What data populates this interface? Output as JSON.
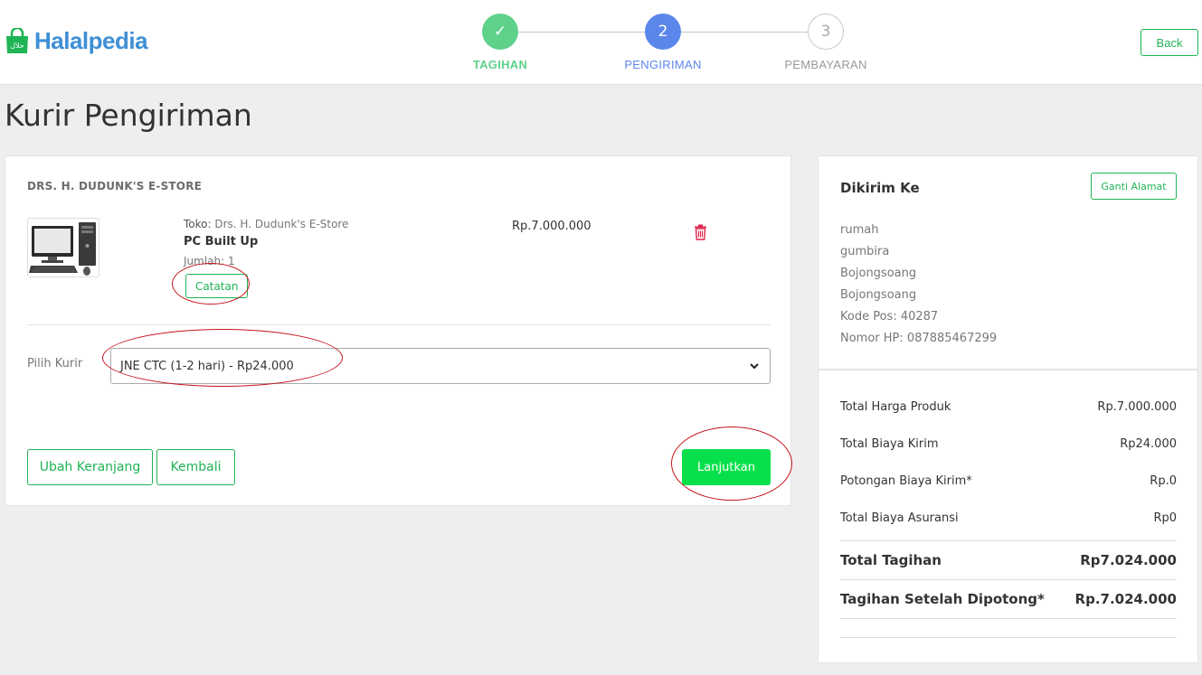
{
  "header": {
    "logo_text": "Halalpedia",
    "logo_badge": "حلال",
    "back_label": "Back",
    "steps": [
      {
        "number": "✓",
        "label": "TAGIHAN",
        "state": "done"
      },
      {
        "number": "2",
        "label": "PENGIRIMAN",
        "state": "active"
      },
      {
        "number": "3",
        "label": "PEMBAYARAN",
        "state": "todo"
      }
    ]
  },
  "page_title": "Kurir Pengiriman",
  "order": {
    "store_name": "DRS. H. DUDUNK'S E-STORE",
    "item": {
      "toko_label": "Toko:",
      "toko_value": "Drs. H. Dudunk's E-Store",
      "name": "PC Built Up",
      "jumlah": "Jumlah: 1",
      "price": "Rp.7.000.000",
      "catatan_label": "Catatan"
    },
    "kurir_label": "Pilih Kurir",
    "kurir_selected": "JNE CTC (1-2 hari) - Rp24.000",
    "ubah_keranjang_label": "Ubah Keranjang",
    "kembali_label": "Kembali",
    "lanjutkan_label": "Lanjutkan"
  },
  "shipping": {
    "title": "Dikirim Ke",
    "ganti_label": "Ganti Alamat",
    "address_lines": [
      "rumah",
      "gumbira",
      "Bojongsoang",
      "Bojongsoang",
      "Kode Pos: 40287",
      "Nomor HP: 087885467299"
    ]
  },
  "summary": {
    "rows": [
      {
        "label": "Total Harga Produk",
        "value": "Rp.7.000.000"
      },
      {
        "label": "Total Biaya Kirim",
        "value": "Rp24.000"
      },
      {
        "label": "Potongan Biaya Kirim*",
        "value": "Rp.0"
      },
      {
        "label": "Total Biaya Asuransi",
        "value": "Rp0"
      }
    ],
    "total_tagihan_label": "Total Tagihan",
    "total_tagihan_value": "Rp7.024.000",
    "setelah_label": "Tagihan Setelah Dipotong*",
    "setelah_value": "Rp.7.024.000"
  },
  "colors": {
    "brand_green": "#1fb455",
    "cta_green": "#07e04b",
    "step_done": "#5ed18a",
    "step_active": "#5b87ec",
    "logo_blue": "#3f8fd6",
    "annotation_red": "#c5141c"
  }
}
